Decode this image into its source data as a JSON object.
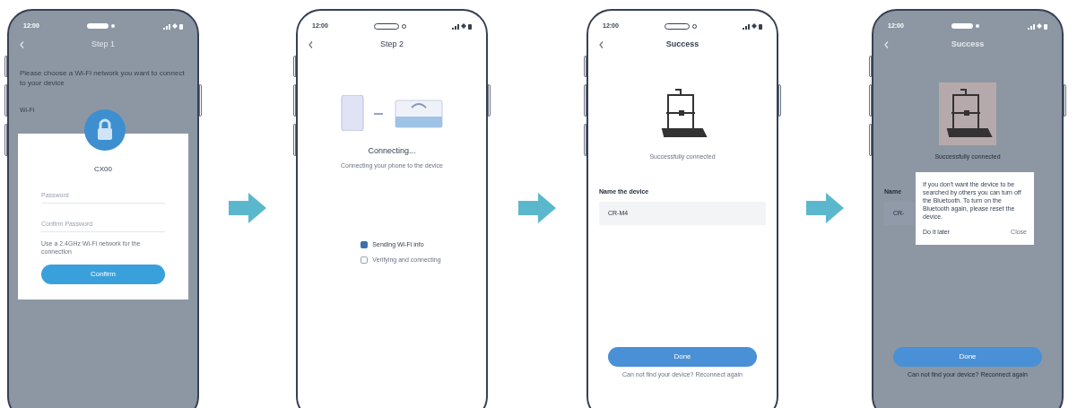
{
  "screens": [
    {
      "kind": "wifi",
      "dimmed": true,
      "time": "12:00",
      "title": "Step 1",
      "prompt": "Please choose a Wi-Fi network you want to connect to your device",
      "network_label": "Wi-Fi",
      "dialog": {
        "network": "CX00",
        "fields": [
          {
            "placeholder": "Password"
          },
          {
            "placeholder": "Confirm Password"
          }
        ],
        "note": "Use a 2.4GHz Wi-Fi network for the connection",
        "button": "Confirm"
      }
    },
    {
      "kind": "connecting",
      "dimmed": false,
      "time": "12:00",
      "title": "Step 2",
      "heading": "Connecting...",
      "subtitle": "Connecting your phone to the device",
      "steps": [
        {
          "label": "Sending Wi-Fi info",
          "checked": true
        },
        {
          "label": "Verifying and connecting",
          "checked": false
        }
      ]
    },
    {
      "kind": "success",
      "dimmed": false,
      "time": "12:00",
      "title": "Success",
      "caption": "Successfully connected",
      "name_label": "Name the device",
      "name_value": "CR-M4",
      "button": "Done",
      "footer": "Can not find your device? Reconnect again"
    },
    {
      "kind": "success",
      "dimmed": true,
      "time": "12:00",
      "title": "Success",
      "caption": "Successfully connected",
      "name_label": "Name",
      "name_value": "CR-",
      "button": "Done",
      "footer": "Can not find your device? Reconnect again",
      "dialog": {
        "message": "If you don't want the device to be searched by others you can turn off the Bluetooth. To turn on the Bluetooth again, please reset the device.",
        "buttons": [
          "Do it later",
          "Close"
        ]
      }
    }
  ]
}
